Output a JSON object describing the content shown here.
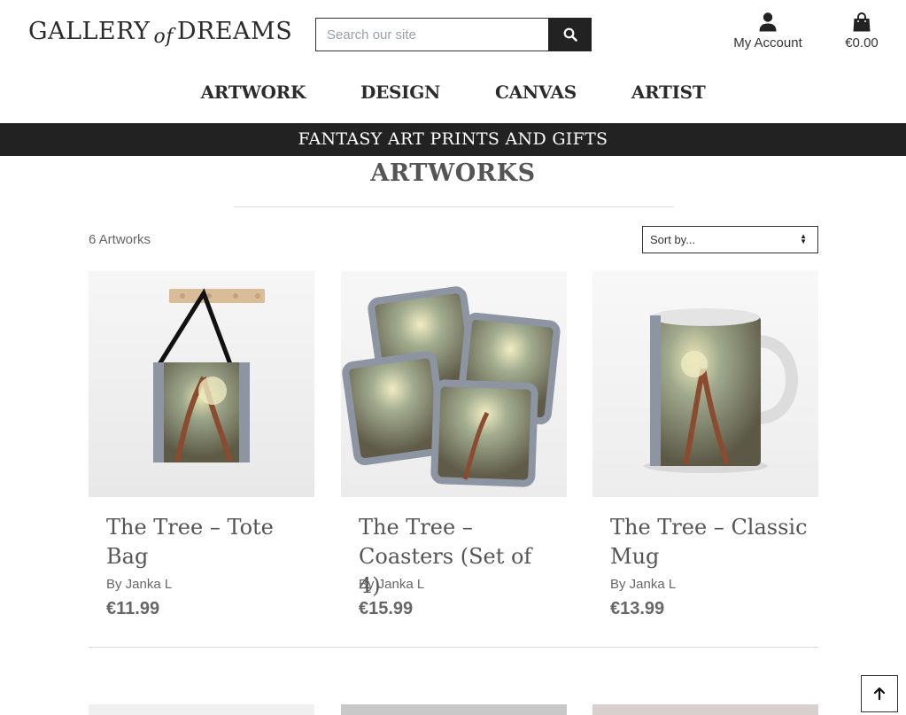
{
  "header": {
    "logo_part1": "GALLERY",
    "logo_part2": "of",
    "logo_part3": "DREAMS",
    "search_placeholder": "Search our site",
    "account_label": "My Account",
    "bag_total": "€0.00"
  },
  "nav": {
    "items": [
      "ARTWORK",
      "DESIGN",
      "CANVAS",
      "ARTIST"
    ]
  },
  "banner": {
    "text": "FANTASY ART PRINTS AND GIFTS"
  },
  "main": {
    "title": "ARTWORKS",
    "count": "6 Artworks",
    "sort_label": "Sort by...",
    "products": [
      {
        "name": "The Tree – Tote Bag",
        "author": "By Janka L",
        "price": "€11.99"
      },
      {
        "name": "The Tree – Coasters (Set of 4)",
        "author": "By Janka L",
        "price": "€15.99"
      },
      {
        "name": "The Tree – Classic Mug",
        "author": "By Janka L",
        "price": "€13.99"
      }
    ]
  },
  "icons": {
    "search": "search-icon",
    "account": "user-icon",
    "bag": "shopping-bag-icon",
    "back_to_top": "arrow-up-icon"
  },
  "colors": {
    "dark": "#222222",
    "text": "#555555",
    "muted": "#666666"
  }
}
